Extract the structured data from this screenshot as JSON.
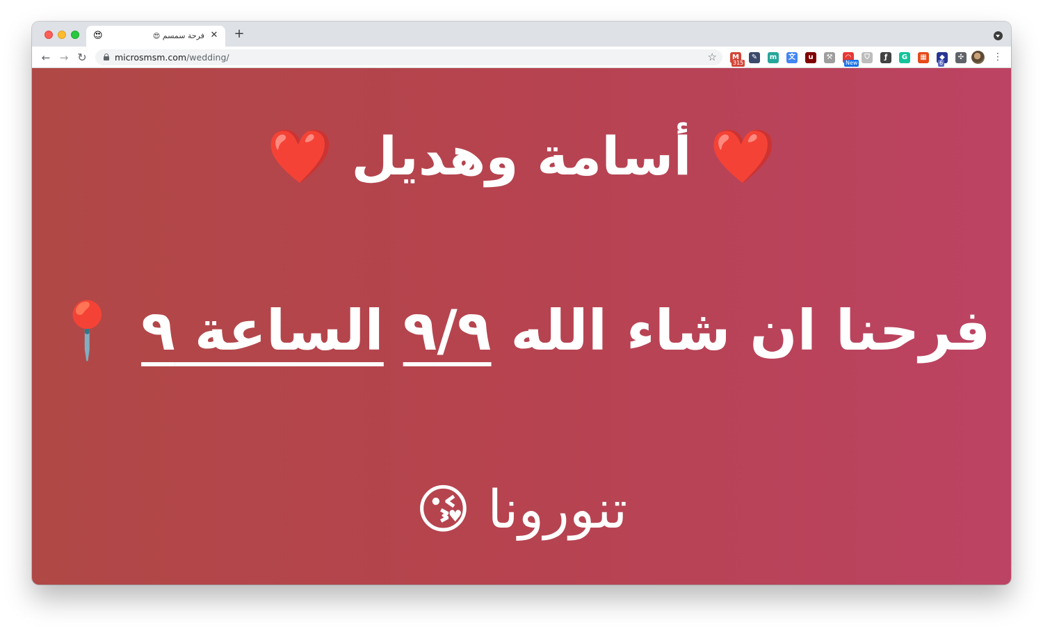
{
  "browser": {
    "tab_title": "فرحة سمسم",
    "tab_title_emoji": "😍",
    "tab_favicon": "😍",
    "tab_close": "✕",
    "new_tab": "+",
    "url_domain": "microsmsm.com",
    "url_path": "/wedding/",
    "back": "←",
    "forward": "→",
    "reload": "↻",
    "star": "☆",
    "menu": "⋮"
  },
  "extensions": [
    {
      "name": "gmail-extension-icon",
      "glyph": "M",
      "color": "#d44638",
      "badge": "315",
      "badge_color": "#d44638"
    },
    {
      "name": "eyedropper-extension-icon",
      "glyph": "✎",
      "color": "#3b4a6b"
    },
    {
      "name": "m-extension-icon",
      "glyph": "m",
      "color": "#26a69a"
    },
    {
      "name": "translate-extension-icon",
      "glyph": "文",
      "color": "#4285f4"
    },
    {
      "name": "ublock-extension-icon",
      "glyph": "u",
      "color": "#800000"
    },
    {
      "name": "tool-extension-icon",
      "glyph": "⚒",
      "color": "#9e9e9e"
    },
    {
      "name": "rainbow-extension-icon",
      "glyph": "◠",
      "color": "#e53935",
      "badge": "New",
      "badge_color": "#1a73e8"
    },
    {
      "name": "shield-extension-icon",
      "glyph": "⛉",
      "color": "#bdbdbd"
    },
    {
      "name": "function-extension-icon",
      "glyph": "ƒ",
      "color": "#424242"
    },
    {
      "name": "grammarly-extension-icon",
      "glyph": "G",
      "color": "#15c39a"
    },
    {
      "name": "grid-extension-icon",
      "glyph": "▦",
      "color": "#e64a19"
    },
    {
      "name": "stack-extension-icon",
      "glyph": "◆",
      "color": "#283593",
      "badge": "6",
      "badge_color": "#5c6bc0"
    },
    {
      "name": "puzzle-extension-icon",
      "glyph": "✣",
      "color": "#5f6368"
    }
  ],
  "page": {
    "line1": {
      "text": "أسامة وهديل",
      "emoji": "❤️"
    },
    "line2": {
      "prefix": "فرحنا ان شاء الله",
      "date": "٩/٩",
      "time": "الساعة ٩",
      "emoji": "📍"
    },
    "line3": {
      "text": "تنورونا",
      "emoji": "😘"
    }
  },
  "colors": {
    "gradient_start": "#b04846",
    "gradient_end": "#bc4363",
    "text": "#ffffff"
  }
}
